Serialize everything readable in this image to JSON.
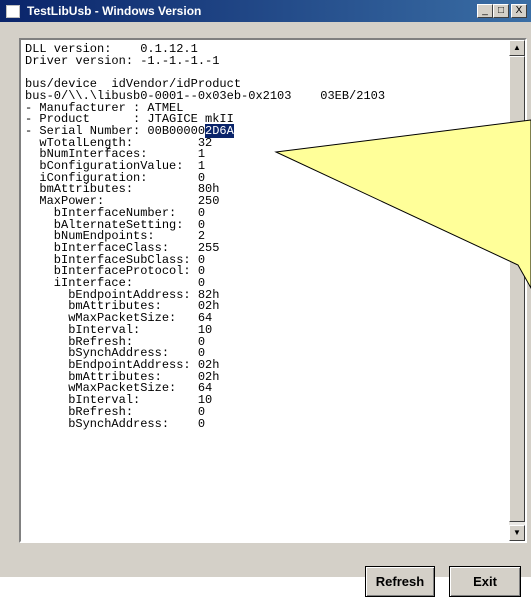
{
  "window": {
    "title": "TestLibUsb - Windows Version"
  },
  "titlebar_buttons": {
    "minimize": "_",
    "maximize": "□",
    "close": "X"
  },
  "output": {
    "before_highlight": "DLL version:    0.1.12.1\nDriver version: -1.-1.-1.-1\n\nbus/device  idVendor/idProduct\nbus-0/\\\\.\\libusb0-0001--0x03eb-0x2103    03EB/2103\n- Manufacturer : ATMEL\n- Product      : JTAGICE mkII\n- Serial Number: 00B00000",
    "highlight": "2D6A",
    "after_highlight": "\n  wTotalLength:         32\n  bNumInterfaces:       1\n  bConfigurationValue:  1\n  iConfiguration:       0\n  bmAttributes:         80h\n  MaxPower:             250\n    bInterfaceNumber:   0\n    bAlternateSetting:  0\n    bNumEndpoints:      2\n    bInterfaceClass:    255\n    bInterfaceSubClass: 0\n    bInterfaceProtocol: 0\n    iInterface:         0\n      bEndpointAddress: 82h\n      bmAttributes:     02h\n      wMaxPacketSize:   64\n      bInterval:        10\n      bRefresh:         0\n      bSynchAddress:    0\n      bEndpointAddress: 02h\n      bmAttributes:     02h\n      wMaxPacketSize:   64\n      bInterval:        10\n      bRefresh:         0\n      bSynchAddress:    0"
  },
  "scrollbar": {
    "up_arrow": "▲",
    "down_arrow": "▼"
  },
  "buttons": {
    "refresh": "Refresh",
    "exit": "Exit"
  },
  "colors": {
    "titlebar": "#0a246a",
    "selection": "#0a246a",
    "callout_fill": "#ffff99",
    "face": "#d4d0c8"
  }
}
